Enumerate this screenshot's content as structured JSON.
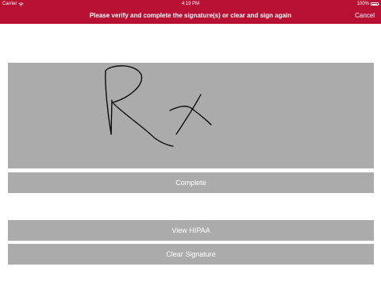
{
  "status_bar": {
    "carrier": "Carrier",
    "time": "4:19 PM",
    "battery_percent": "100%",
    "icons": [
      "wifi-icon",
      "battery-icon"
    ]
  },
  "nav_bar": {
    "title": "Please verify and complete the signature(s) or clear and sign again",
    "cancel_label": "Cancel"
  },
  "signature_pad": {
    "has_signature": true
  },
  "actions": {
    "complete_label": "Complete",
    "view_hipaa_label": "View HIPAA",
    "clear_signature_label": "Clear Signature"
  },
  "colors": {
    "brand": "#b71033",
    "button_bg": "#ababab",
    "pad_bg": "#ababab",
    "text_on_brand": "#ffffff",
    "stroke": "#000000"
  }
}
